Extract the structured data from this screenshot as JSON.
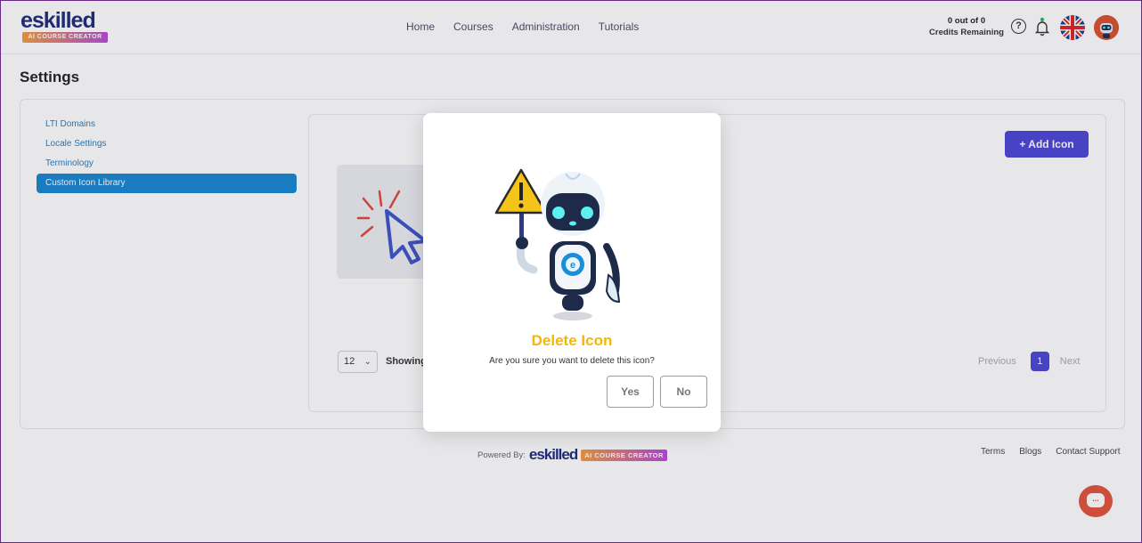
{
  "header": {
    "logo_word": "eskilled",
    "logo_tagline": "AI COURSE CREATOR",
    "nav": [
      "Home",
      "Courses",
      "Administration",
      "Tutorials"
    ],
    "credits_line1": "0 out of 0",
    "credits_line2": "Credits Remaining",
    "help_glyph": "?"
  },
  "page": {
    "title": "Settings",
    "sidebar": [
      {
        "label": "LTI Domains",
        "active": false
      },
      {
        "label": "Locale Settings",
        "active": false
      },
      {
        "label": "Terminology",
        "active": false
      },
      {
        "label": "Custom Icon Library",
        "active": true
      }
    ],
    "add_button": "+ Add Icon",
    "per_page": "12",
    "showing_label": "Showing",
    "pager": {
      "previous": "Previous",
      "current": "1",
      "next": "Next"
    }
  },
  "footer": {
    "powered_by": "Powered By:",
    "logo_word": "eskilled",
    "logo_tagline": "AI COURSE CREATOR",
    "links": [
      "Terms",
      "Blogs",
      "Contact Support"
    ]
  },
  "modal": {
    "title": "Delete Icon",
    "message": "Are you sure you want to delete this icon?",
    "yes": "Yes",
    "no": "No"
  },
  "colors": {
    "accent": "#4b44d6",
    "sidebar_active": "#1585d1",
    "warning_title": "#f5b800",
    "chat": "#e2533a"
  }
}
